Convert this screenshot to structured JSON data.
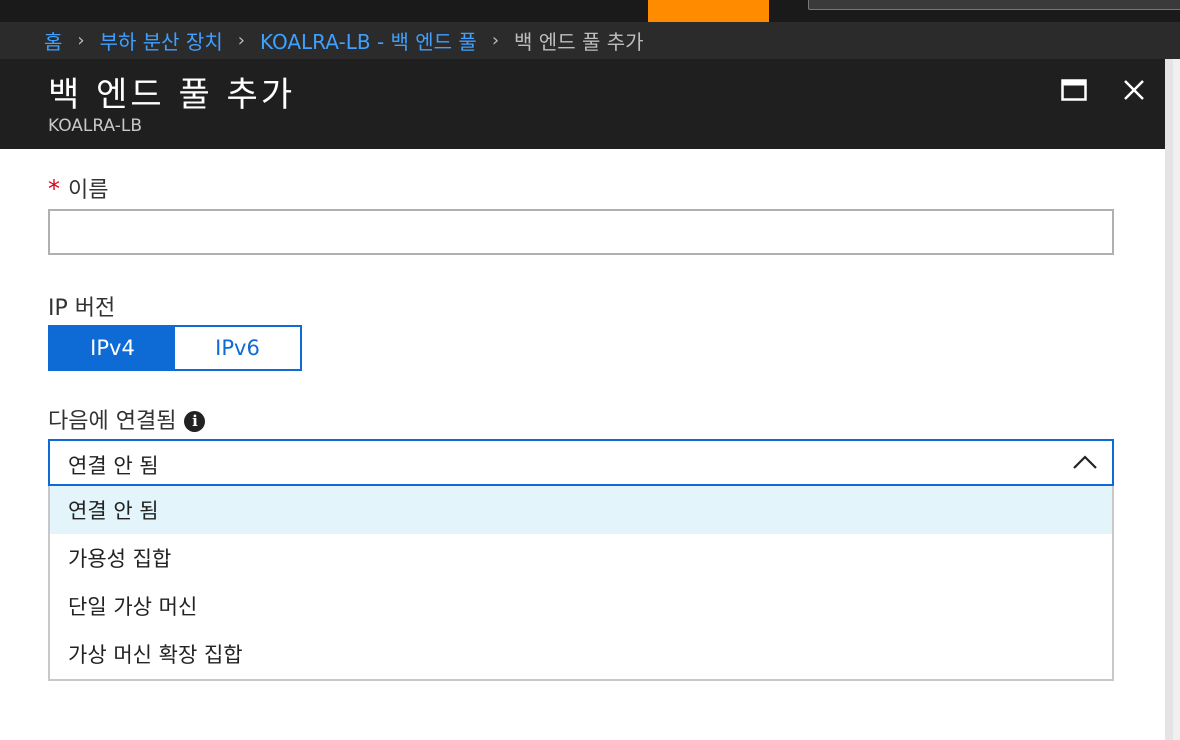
{
  "colors": {
    "accent_orange": "#ff8c00",
    "link_blue": "#3fa0ff",
    "primary_blue": "#0e6ad4",
    "required_red": "#d9001b",
    "highlight_row": "#e3f4fb"
  },
  "breadcrumb": {
    "items": [
      {
        "label": "홈"
      },
      {
        "label": "부하 분산 장치"
      },
      {
        "label": "KOALRA-LB - 백 엔드 풀"
      },
      {
        "label": "백 엔드 풀 추가"
      }
    ]
  },
  "blade": {
    "title": "백 엔드 풀 추가",
    "subtitle": "KOALRA-LB",
    "maximize_icon": "maximize-icon",
    "close_icon": "close-icon"
  },
  "form": {
    "name": {
      "required_marker": "*",
      "label": "이름",
      "value": "",
      "placeholder": ""
    },
    "ip_version": {
      "label": "IP 버전",
      "options": [
        "IPv4",
        "IPv6"
      ],
      "selected": "IPv4"
    },
    "associated_to": {
      "label": "다음에 연결됨",
      "info_icon": "info-icon",
      "selected_value": "연결 안 됨",
      "expanded": true,
      "options": [
        "연결 안 됨",
        "가용성 집합",
        "단일 가상 머신",
        "가상 머신 확장 집합"
      ]
    }
  }
}
